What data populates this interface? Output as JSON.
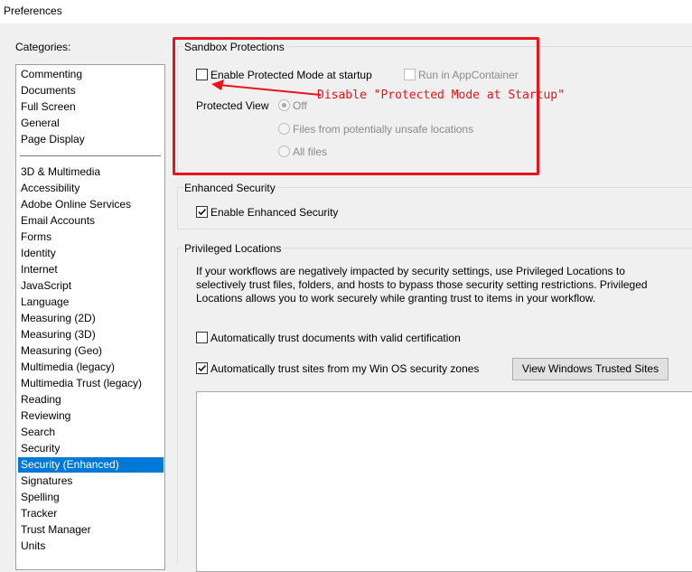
{
  "window": {
    "title": "Preferences"
  },
  "categories": {
    "label": "Categories:",
    "top_items": [
      "Commenting",
      "Documents",
      "Full Screen",
      "General",
      "Page Display"
    ],
    "items": [
      "3D & Multimedia",
      "Accessibility",
      "Adobe Online Services",
      "Email Accounts",
      "Forms",
      "Identity",
      "Internet",
      "JavaScript",
      "Language",
      "Measuring (2D)",
      "Measuring (3D)",
      "Measuring (Geo)",
      "Multimedia (legacy)",
      "Multimedia Trust (legacy)",
      "Reading",
      "Reviewing",
      "Search",
      "Security",
      "Security (Enhanced)",
      "Signatures",
      "Spelling",
      "Tracker",
      "Trust Manager",
      "Units"
    ],
    "selected": "Security (Enhanced)"
  },
  "sandbox": {
    "title": "Sandbox Protections",
    "protected_mode_label": "Enable Protected Mode at startup",
    "protected_mode_checked": false,
    "appcontainer_label": "Run in AppContainer",
    "appcontainer_checked": false,
    "protected_view_label": "Protected View",
    "pv_options": [
      "Off",
      "Files from potentially unsafe locations",
      "All files"
    ],
    "pv_selected": "Off"
  },
  "annotation": {
    "text": "Disable \"Protected Mode at Startup\"",
    "color": "#e8141c"
  },
  "enhanced": {
    "title": "Enhanced Security",
    "enable_label": "Enable Enhanced Security",
    "enable_checked": true
  },
  "privileged": {
    "title": "Privileged Locations",
    "description": "If your workflows are negatively impacted by security settings, use Privileged Locations to selectively trust files, folders, and hosts to bypass those security setting restrictions. Privileged Locations allows you to work securely while granting trust to items in your workflow.",
    "trust_cert_label": "Automatically trust documents with valid certification",
    "trust_cert_checked": false,
    "trust_sites_label": "Automatically trust sites from my Win OS security zones",
    "trust_sites_checked": true,
    "view_sites_button": "View Windows Trusted Sites"
  },
  "colors": {
    "selection": "#0078d7",
    "annotation_red": "#e8141c"
  }
}
